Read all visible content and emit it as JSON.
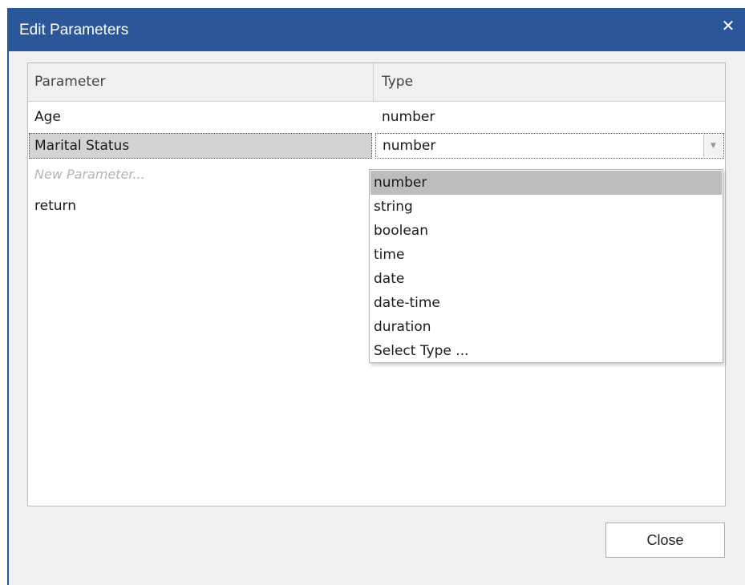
{
  "window": {
    "title": "Edit Parameters"
  },
  "grid": {
    "columns": [
      "Parameter",
      "Type"
    ],
    "rows": [
      {
        "parameter": "Age",
        "type": "number"
      },
      {
        "parameter": "Marital Status",
        "type": "number"
      },
      {
        "parameter": "New Parameter...",
        "type": ""
      },
      {
        "parameter": "return",
        "type": ""
      }
    ]
  },
  "dropdown": {
    "options": [
      "number",
      "string",
      "boolean",
      "time",
      "date",
      "date-time",
      "duration",
      "Select Type ..."
    ],
    "highlighted": "number"
  },
  "buttons": {
    "close": "Close"
  },
  "icons": {
    "close": "close-icon",
    "dropdown": "chevron-down-icon"
  },
  "colors": {
    "title_bar": "#2b579a",
    "selection": "#d3d3d3",
    "highlight": "#bdbdbd"
  }
}
